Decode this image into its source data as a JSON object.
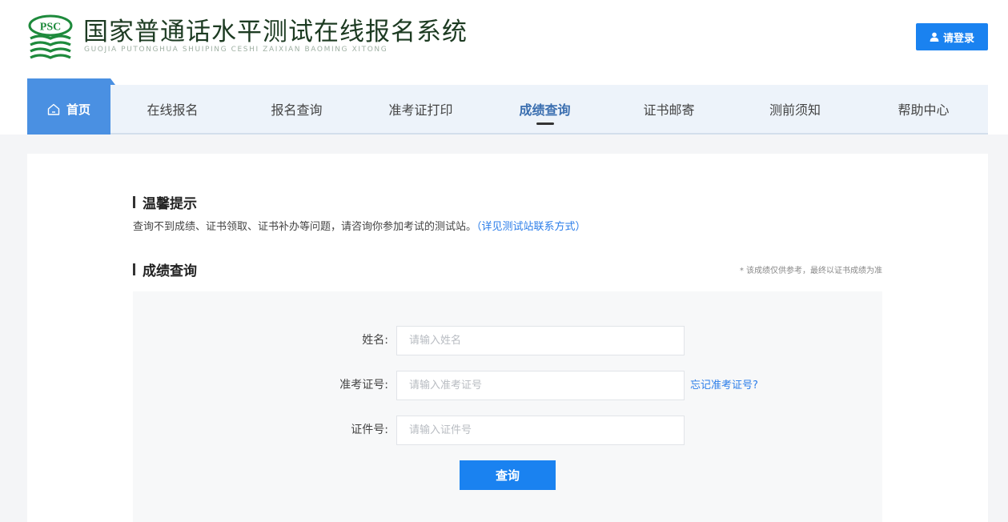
{
  "header": {
    "logo_text": "PSC",
    "title": "国家普通话水平测试在线报名系统",
    "subtitle": "GUOJIA PUTONGHUA SHUIPING CESHI ZAIXIAN BAOMING XITONG",
    "login_label": "请登录",
    "login_icon": "user-icon"
  },
  "nav": {
    "home_label": "首页",
    "home_icon": "home-icon",
    "items": [
      {
        "label": "在线报名"
      },
      {
        "label": "报名查询"
      },
      {
        "label": "准考证打印"
      },
      {
        "label": "成绩查询",
        "active": true
      },
      {
        "label": "证书邮寄"
      },
      {
        "label": "测前须知"
      },
      {
        "label": "帮助中心"
      }
    ]
  },
  "tip": {
    "heading": "温馨提示",
    "text": "查询不到成绩、证书领取、证书补办等问题，请咨询你参加考试的测试站。",
    "link": "（详见测试站联系方式）"
  },
  "query": {
    "heading": "成绩查询",
    "note": "* 该成绩仅供参考，最终以证书成绩为准",
    "fields": [
      {
        "label": "姓名:",
        "placeholder": "请输入姓名"
      },
      {
        "label": "准考证号:",
        "placeholder": "请输入准考证号"
      },
      {
        "label": "证件号:",
        "placeholder": "请输入证件号"
      }
    ],
    "forgot_link": "忘记准考证号?",
    "submit_label": "查询"
  },
  "colors": {
    "primary": "#1a82f0",
    "nav_bg": "#edf3fa",
    "home_tab": "#4a90e2",
    "link": "#2b7de9",
    "logo_green": "#1e8a3c"
  }
}
